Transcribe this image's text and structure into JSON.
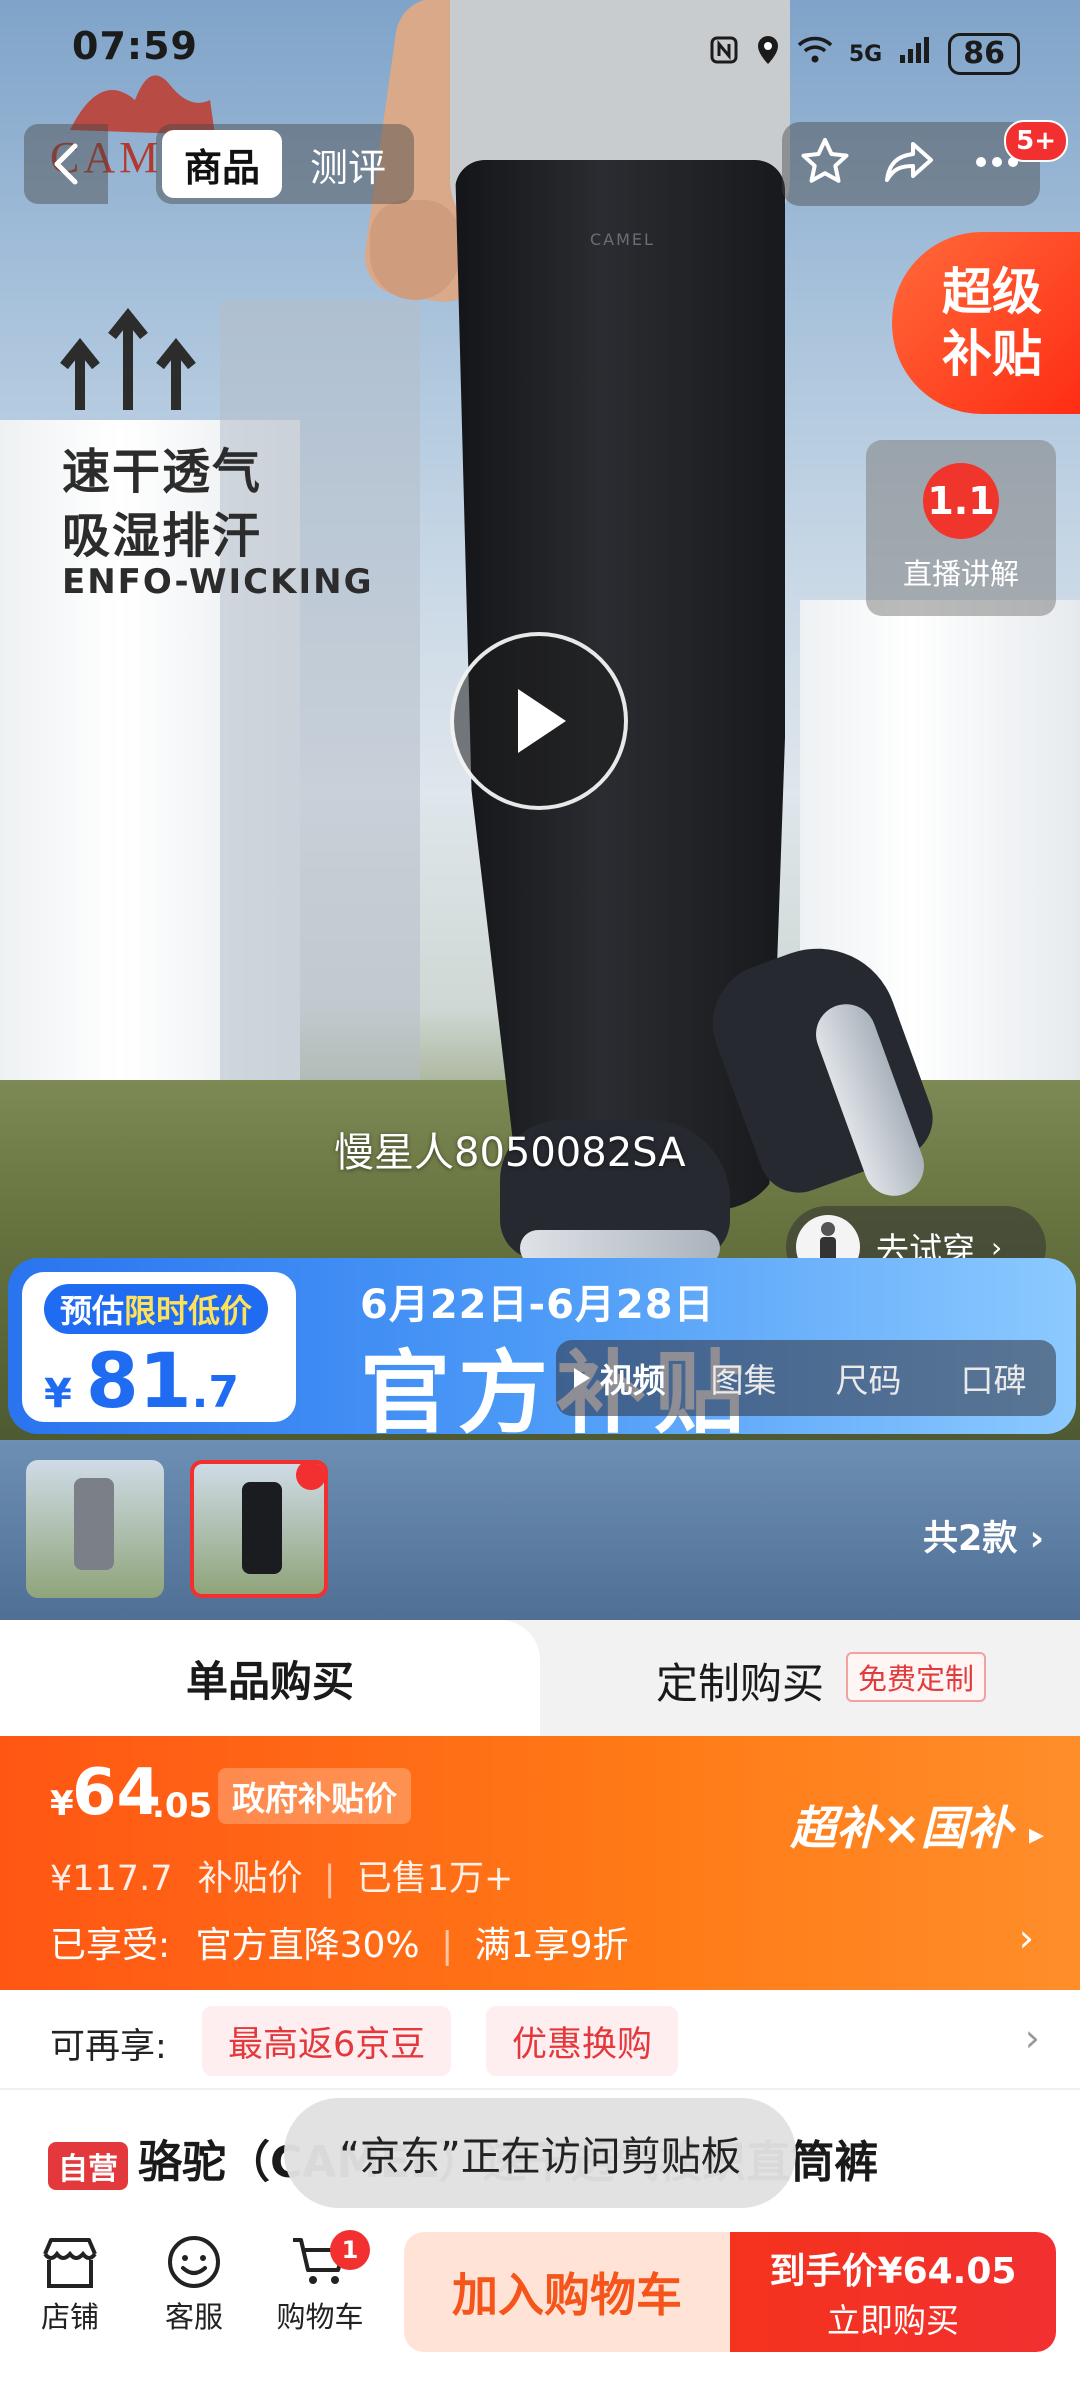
{
  "status_bar": {
    "time": "07:59",
    "network": "5G",
    "battery": "86"
  },
  "header": {
    "tabs": [
      {
        "label": "商品",
        "active": true
      },
      {
        "label": "测评",
        "active": false
      }
    ],
    "more_badge": "5+"
  },
  "hero": {
    "brand_logo": "CAMEL",
    "pants_brand": "CAMEL",
    "ad_lines": [
      "速干透气",
      "吸湿排汗"
    ],
    "ad_en": "ENFO-WICKING",
    "model_name": "慢星人8050082SA",
    "super_subsidy": [
      "超级",
      "补贴"
    ],
    "live_label": "直播讲解",
    "live_icon_text": "1.1",
    "try_on": "去试穿",
    "price_banner": {
      "label_pre": "预估",
      "label_hl": "限时低价",
      "currency": "¥",
      "price_int": "81",
      "price_dec": ".7",
      "date_range": "6月22日-6月28日",
      "headline": "官方补贴"
    },
    "media_tabs": [
      "视频",
      "图集",
      "尺码",
      "口碑"
    ]
  },
  "variants": {
    "count_label": "共2款"
  },
  "mode_tabs": {
    "single": "单品购买",
    "custom": "定制购买",
    "custom_tag": "免费定制"
  },
  "price": {
    "currency": "¥",
    "int": "64",
    "dec": ".05",
    "tag": "政府补贴价",
    "orig_price": "¥117.7",
    "orig_label": "补贴价",
    "sold": "已售1万+",
    "enjoyed_label": "已享受:",
    "discount1": "官方直降30%",
    "discount2": "满1享9折",
    "right_label": "超补×国补"
  },
  "benefits": {
    "label": "可再享:",
    "tags": [
      "最高返6京豆",
      "优惠换购"
    ]
  },
  "product": {
    "self_tag": "自营",
    "title": "骆驼（CAMEL）速干透气梭织直筒裤"
  },
  "toast": "“京东”正在访问剪贴板",
  "bottom_bar": {
    "store": "店铺",
    "service": "客服",
    "cart": "购物车",
    "cart_count": "1",
    "add_cart": "加入购物车",
    "buy_price_label": "到手价¥64.05",
    "buy_now": "立即购买"
  },
  "colors": {
    "accent": "#f23030",
    "orange": "#ff5614",
    "blue": "#1f6cf2"
  }
}
